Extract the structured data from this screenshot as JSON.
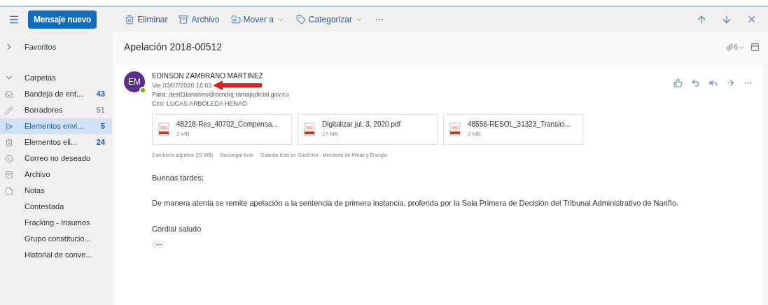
{
  "toolbar": {
    "new_message": "Mensaje nuevo",
    "actions": [
      {
        "kind": "trash",
        "label": "Eliminar",
        "dropdown": false
      },
      {
        "kind": "archive",
        "label": "Archivo",
        "dropdown": false
      },
      {
        "kind": "move",
        "label": "Mover a",
        "dropdown": true
      },
      {
        "kind": "tag",
        "label": "Categorizar",
        "dropdown": true
      }
    ]
  },
  "sidebar": {
    "favorites": "Favoritos",
    "folders_header": "Carpetas",
    "items": [
      {
        "kind": "inbox",
        "label": "Bandeja de ent...",
        "count": "43",
        "selected": false
      },
      {
        "kind": "draft",
        "label": "Borradores",
        "count": "51",
        "selected": false
      },
      {
        "kind": "sent",
        "label": "Elementos envi...",
        "count": "5",
        "selected": true
      },
      {
        "kind": "trash",
        "label": "Elementos eli...",
        "count": "24",
        "selected": false
      },
      {
        "kind": "junk",
        "label": "Correo no deseado",
        "selected": false
      },
      {
        "kind": "archive",
        "label": "Archivo",
        "selected": false
      },
      {
        "kind": "note",
        "label": "Notas",
        "selected": false
      },
      {
        "kind": "plain",
        "label": "Contestada",
        "selected": false
      },
      {
        "kind": "plain",
        "label": "Fracking - Insumos",
        "selected": false
      },
      {
        "kind": "plain",
        "label": "Grupo constitucio...",
        "selected": false
      },
      {
        "kind": "plain",
        "label": "Historial de conve...",
        "selected": false
      }
    ]
  },
  "conversation": {
    "subject": "Apelación 2018-00512",
    "attachment_count": "6"
  },
  "message": {
    "avatar_initials": "EM",
    "sender": "EDINSON ZAMBRANO MARTINEZ",
    "date": "Vie 03/07/2020 16:02",
    "to": "Para: des01tanarino@cendoj.ramajudicial.gov.co",
    "bcc": "Cco: LUCAS ARBOLEDA HENAO",
    "attachments": [
      {
        "name": "48218-Res_40702_Compensa...",
        "size": "2 MB"
      },
      {
        "name": "Digitalizar jul. 3, 2020.pdf",
        "size": "17 MB"
      },
      {
        "name": "48556-RESOL_31323_Transici...",
        "size": "2 MB"
      }
    ],
    "attachments_summary": "3 archivos adjuntos (21 MB)",
    "download_all": "Descargar todo",
    "save_all": "Guardar todo en OneDrive - Ministerio de Minas y Energía",
    "body": [
      "Buenas tardes;",
      "De manera atenta se remite apelación a la sentencia de primera instancia, proferida por la Sala Primera de Decisión del Tribunal Administrativo de Nariño.",
      "Cordial saludo"
    ]
  }
}
